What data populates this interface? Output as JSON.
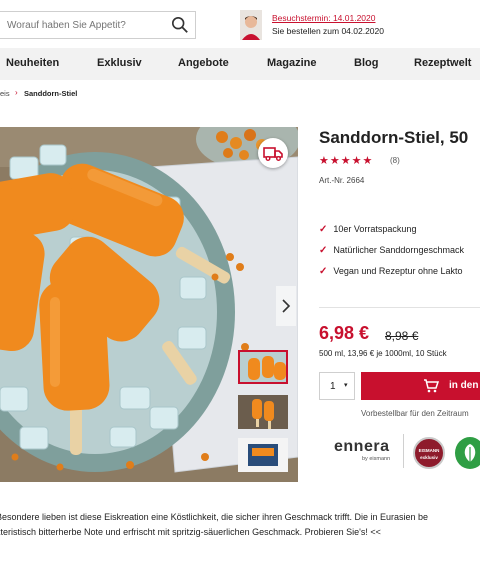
{
  "header": {
    "search_placeholder": "Worauf haben Sie Appetit?",
    "visit_link": "Besuchstermin: 14.01.2020",
    "order_note": "Sie bestellen zum 04.02.2020"
  },
  "nav": {
    "items": [
      {
        "label": "Neuheiten"
      },
      {
        "label": "Exklusiv"
      },
      {
        "label": "Angebote"
      },
      {
        "label": "Magazine"
      },
      {
        "label": "Blog"
      },
      {
        "label": "Rezeptwelt"
      }
    ]
  },
  "breadcrumb": {
    "parent": "eis",
    "current": "Sanddorn-Stiel"
  },
  "product": {
    "title": "Sanddorn-Stiel, 50",
    "stars": "★★★★★",
    "rating": 5,
    "review_count": "(8)",
    "article_no": "Art.-Nr. 2664",
    "features": [
      "10er Vorratspackung",
      "Natürlicher Sanddorngeschmack",
      "Vegan und Rezeptur ohne Lakto"
    ],
    "price": "6,98 €",
    "old_price": "8,98 €",
    "unit_price": "500 ml, 13,96 € je 1000ml, 10 Stück",
    "quantity": "1",
    "cart_label": "in den",
    "preorder_note": "Vorbestellbar für den Zeitraum"
  },
  "brands": {
    "name": "ennera",
    "sub": "by eismann",
    "exklusiv_top": "EISMANN",
    "exklusiv_bottom": "exklusiv"
  },
  "description": {
    "line1": "Besondere lieben ist diese Eiskreation eine Köstlichkeit, die sicher ihren Geschmack trifft. Die in Eurasien be",
    "line2": "kteristisch bitterherbe Note und erfrischt mit spritzig-säuerlichen Geschmack. Probieren Sie's! <<"
  },
  "colors": {
    "accent": "#c8102e",
    "popsicle": "#f08a1e",
    "nav_bg": "#f2f2f2",
    "vegan_badge": "#2f9e44"
  },
  "icons": [
    "search-icon",
    "delivery-truck-icon",
    "cart-icon",
    "chevron-right-icon",
    "check-icon",
    "vegan-leaf-icon"
  ]
}
